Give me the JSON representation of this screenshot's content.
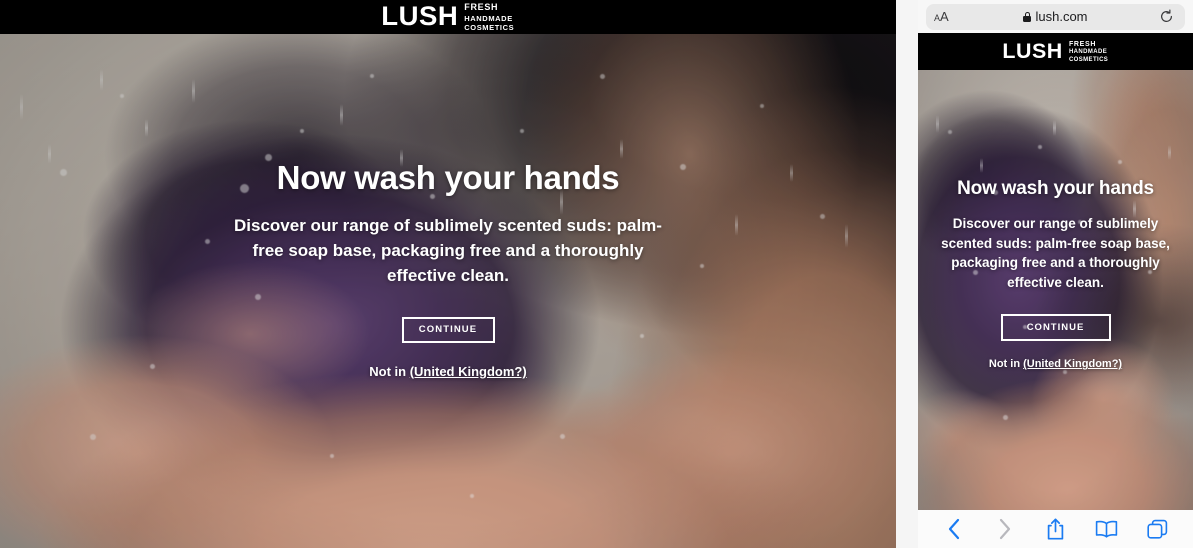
{
  "desktop": {
    "header": {
      "logo_word": "LUSH",
      "logo_line1": "FRESH",
      "logo_line2": "HANDMADE",
      "logo_line3": "COSMETICS"
    },
    "hero": {
      "headline": "Now wash your hands",
      "subcopy": "Discover our range of sublimely scented suds: palm-free soap base, packaging free and a thoroughly effective clean.",
      "continue_label": "CONTINUE",
      "not_in_prefix": "Not in ",
      "not_in_link": "(United Kingdom?)"
    }
  },
  "mobile": {
    "browser": {
      "text_size_small": "A",
      "text_size_large": "A",
      "url": "lush.com",
      "lock_icon": "lock-icon",
      "reload_icon": "reload-icon",
      "back_icon": "chevron-left-icon",
      "forward_icon": "chevron-right-icon",
      "share_icon": "share-icon",
      "bookmarks_icon": "book-icon",
      "tabs_icon": "tabs-icon"
    },
    "header": {
      "logo_word": "LUSH",
      "logo_line1": "FRESH",
      "logo_line2": "HANDMADE",
      "logo_line3": "COSMETICS"
    },
    "hero": {
      "headline": "Now wash your hands",
      "subcopy": "Discover our range of sublimely scented suds: palm-free soap base, packaging free and a thoroughly effective clean.",
      "continue_label": "CONTINUE",
      "not_in_prefix": "Not in ",
      "not_in_link": "(United Kingdom?)"
    }
  },
  "colors": {
    "brand_black": "#000000",
    "text_white": "#ffffff",
    "safari_chrome": "#f7f7f7",
    "safari_accent": "#1a7bf2",
    "disabled_gray": "#b8b8bd"
  }
}
